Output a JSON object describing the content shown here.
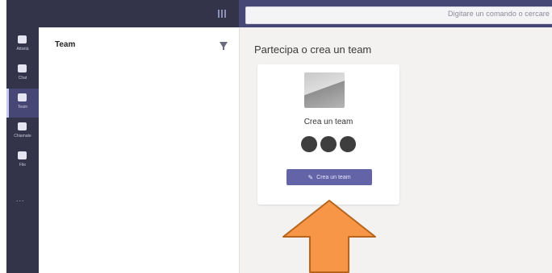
{
  "search": {
    "placeholder_text": "Digitare un comando o cercare"
  },
  "sidebar": {
    "items": [
      {
        "name": "Attività",
        "icon": "bell-icon"
      },
      {
        "name": "Chat",
        "icon": "chat-icon"
      },
      {
        "name": "Team",
        "icon": "teams-icon",
        "active": true
      },
      {
        "name": "Chiamate",
        "icon": "phone-icon"
      },
      {
        "name": "File",
        "icon": "file-icon"
      }
    ],
    "more": "..."
  },
  "teams_panel": {
    "title": "Team"
  },
  "main": {
    "title": "Partecipa o crea un team",
    "card": {
      "label": "Crea un team",
      "button_label": "Crea un team",
      "button_icon": "pencil-icon"
    }
  },
  "colors": {
    "rail": "#33344a",
    "topbar": "#464775",
    "accent": "#6264a7",
    "annotation_arrow": "#f79646"
  }
}
